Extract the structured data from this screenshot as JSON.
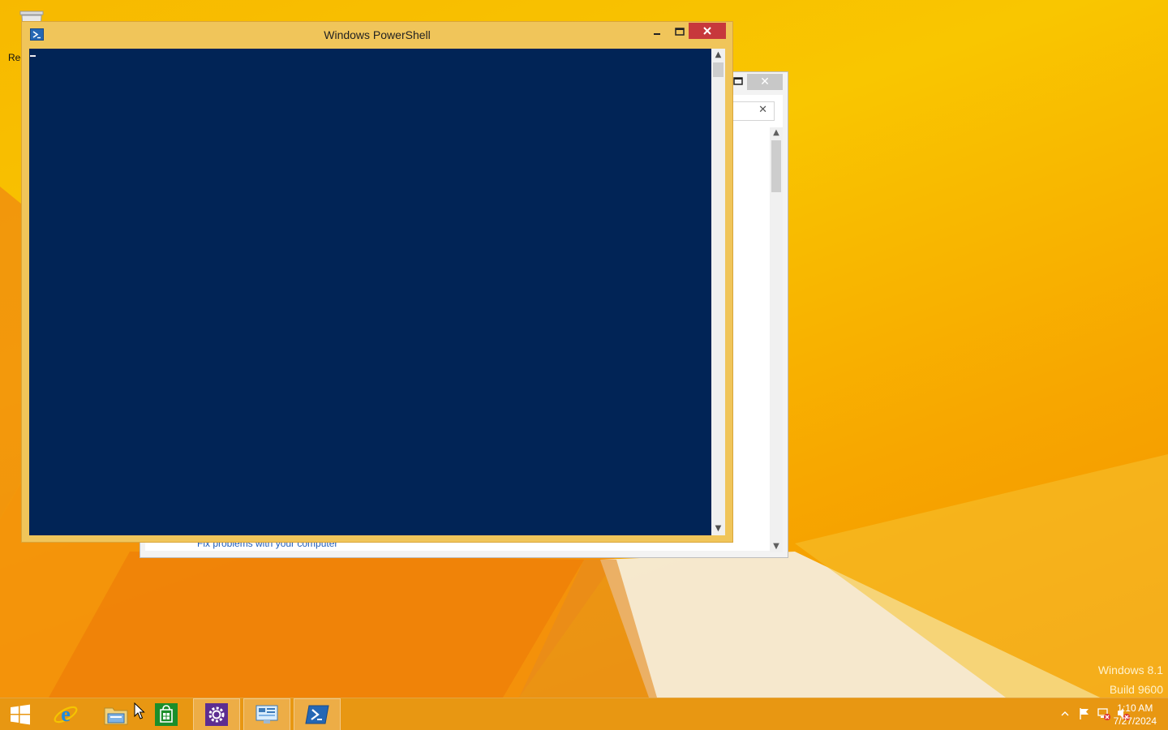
{
  "desktop": {
    "recycle_bin_label": "Rec",
    "watermark": {
      "line1": "Windows 8.1",
      "line2": "Build 9600"
    }
  },
  "background_window": {
    "close_symbol": "✕",
    "search_clear_symbol": "✕",
    "link_text": "Fix problems with your computer"
  },
  "powershell_window": {
    "title": "Windows PowerShell",
    "console_text": ""
  },
  "taskbar": {
    "items": [
      {
        "name": "start-button",
        "icon": "windows-logo-icon",
        "active": false
      },
      {
        "name": "internet-explorer",
        "icon": "internet-explorer-icon",
        "active": false
      },
      {
        "name": "file-explorer",
        "icon": "folder-icon",
        "active": false
      },
      {
        "name": "store",
        "icon": "store-bag-icon",
        "active": false
      },
      {
        "name": "pc-settings",
        "icon": "gear-icon",
        "active": true
      },
      {
        "name": "control-panel",
        "icon": "control-panel-icon",
        "active": true
      },
      {
        "name": "powershell",
        "icon": "powershell-icon",
        "active": true
      }
    ],
    "clock": {
      "time": "1:10 AM",
      "date": "7/27/2024"
    }
  },
  "colors": {
    "console_bg": "#012456",
    "titlebar_active": "#f0c55a",
    "close_red": "#c7383c",
    "taskbar": "#e69614"
  }
}
